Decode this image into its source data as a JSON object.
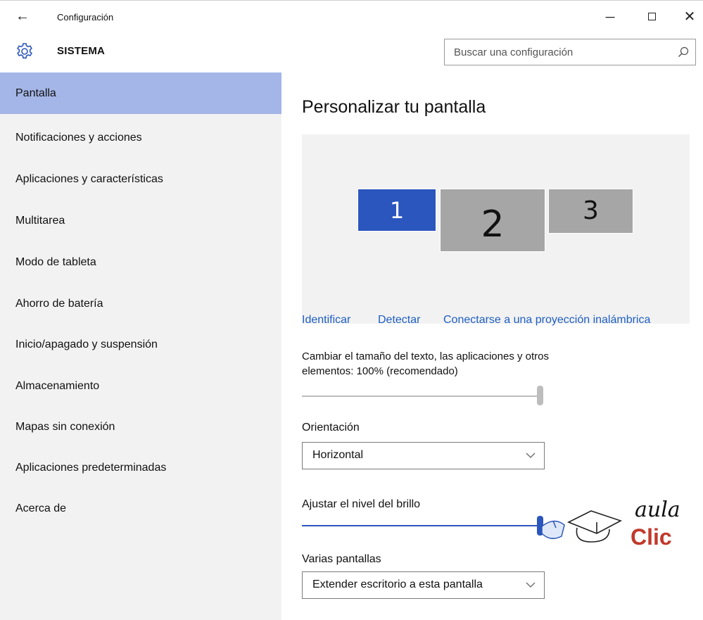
{
  "window": {
    "title": "Configuración",
    "back_glyph": "←",
    "minimize_glyph": "─",
    "close_glyph": "✕"
  },
  "header": {
    "section_icon": "gear-icon",
    "section_title": "SISTEMA",
    "search_placeholder": "Buscar una configuración"
  },
  "sidebar": {
    "items": [
      {
        "label": "Pantalla",
        "active": true
      },
      {
        "label": "Notificaciones y acciones"
      },
      {
        "label": "Aplicaciones y características"
      },
      {
        "label": "Multitarea"
      },
      {
        "label": "Modo de tableta"
      },
      {
        "label": "Ahorro de batería"
      },
      {
        "label": "Inicio/apagado y suspensión"
      },
      {
        "label": "Almacenamiento"
      },
      {
        "label": "Mapas sin conexión"
      },
      {
        "label": "Aplicaciones predeterminadas"
      },
      {
        "label": "Acerca de"
      }
    ]
  },
  "main": {
    "title": "Personalizar tu pantalla",
    "monitors": [
      "1",
      "2",
      "3"
    ],
    "links": [
      "Identificar",
      "Detectar",
      "Conectarse a una proyección inalámbrica"
    ],
    "scale_label_line1": "Cambiar el tamaño del texto, las aplicaciones y otros",
    "scale_label_line2": "elementos: 100% (recomendado)",
    "scale_slider_level": 1.0,
    "orientation_label": "Orientación",
    "orientation_value": "Horizontal",
    "brightness_label": "Ajustar el nivel del brillo",
    "brightness_level": 1.0,
    "multi_display_label": "Varias pantallas",
    "multi_display_value": "Extender escritorio a esta pantalla"
  },
  "logo": {
    "line1": "aula",
    "line2": "Clic"
  },
  "colors": {
    "accent": "#2b56bd",
    "link": "#1f5fc4",
    "sidebar_active": "#a4b6e7",
    "sidebar_bg": "#f2f2f2",
    "logo_red": "#c0392b"
  }
}
